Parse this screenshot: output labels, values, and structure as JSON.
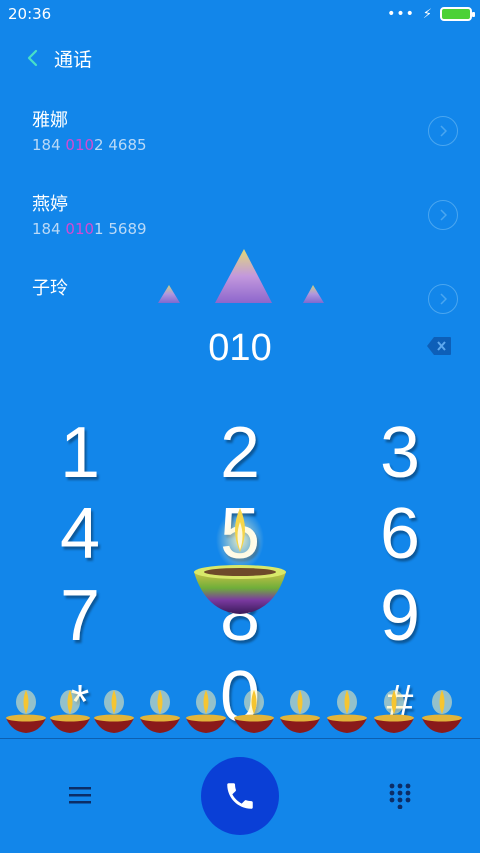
{
  "status": {
    "time": "20:36",
    "dots": "•••",
    "bolt": "⚡",
    "battery_level": 1.0
  },
  "header": {
    "title": "通话"
  },
  "contacts": [
    {
      "name": "雅娜",
      "num_prefix": "184 ",
      "num_match": "010",
      "num_suffix": "2 4685"
    },
    {
      "name": "燕婷",
      "num_prefix": "184 ",
      "num_match": "010",
      "num_suffix": "1 5689"
    },
    {
      "name": "子玲",
      "num_prefix": "",
      "num_match": "",
      "num_suffix": ""
    }
  ],
  "dialer": {
    "input": "010"
  },
  "keys": [
    "1",
    "2",
    "3",
    "4",
    "5",
    "6",
    "7",
    "8",
    "9",
    "*",
    "0",
    "#"
  ],
  "colors": {
    "background": "#1286ea",
    "call_button": "#0a3fd6",
    "highlight": "#d34bd3",
    "back_arrow": "#48e0c8"
  }
}
